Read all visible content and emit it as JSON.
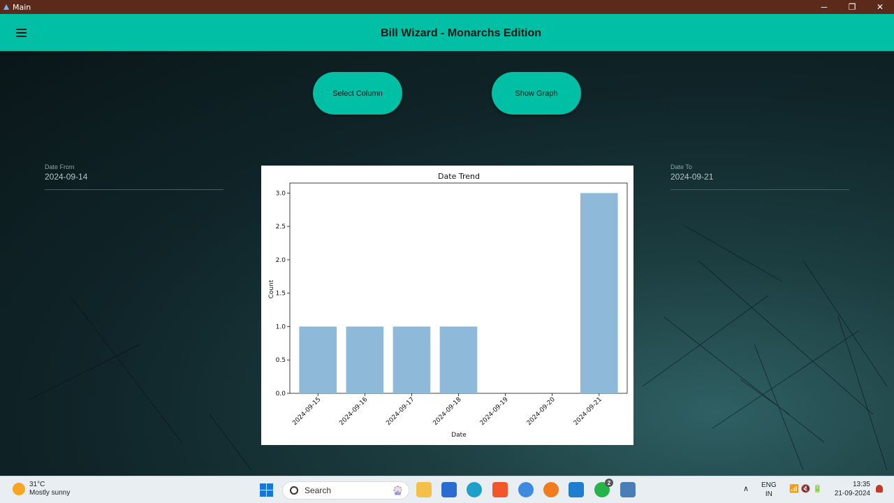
{
  "window": {
    "title": "Main",
    "controls": {
      "minimize": "─",
      "restore": "❐",
      "close": "✕"
    }
  },
  "toolbar": {
    "title": "Bill Wizard - Monarchs Edition",
    "menu_icon": "hamburger-menu-icon"
  },
  "buttons": {
    "select_column": "Select Column",
    "show_graph": "Show Graph"
  },
  "date_from": {
    "label": "Date From",
    "value": "2024-09-14"
  },
  "date_to": {
    "label": "Date To",
    "value": "2024-09-21"
  },
  "chart_data": {
    "type": "bar",
    "title": "Date Trend",
    "xlabel": "Date",
    "ylabel": "Count",
    "categories": [
      "2024-09-15",
      "2024-09-16",
      "2024-09-17",
      "2024-09-18",
      "2024-09-19",
      "2024-09-20",
      "2024-09-21"
    ],
    "values": [
      1,
      1,
      1,
      1,
      0,
      0,
      3
    ],
    "ylim": [
      0,
      3.15
    ],
    "yticks": [
      "0.0",
      "0.5",
      "1.0",
      "1.5",
      "2.0",
      "2.5",
      "3.0"
    ],
    "bar_color": "#8fb9d8",
    "grid": false
  },
  "taskbar": {
    "weather": {
      "temp": "31°C",
      "desc": "Mostly sunny"
    },
    "search_label": "Search",
    "apps": [
      "file-explorer-icon",
      "store-icon",
      "edge-icon",
      "brave-icon",
      "app-icon",
      "firefox-icon",
      "vscode-icon",
      "whatsapp-icon",
      "python-icon"
    ],
    "whatsapp_badge": "2",
    "tray": {
      "lang_line1": "ENG",
      "lang_line2": "IN",
      "time": "13:35",
      "date": "21-09-2024"
    }
  },
  "colors": {
    "accent": "#00bfa5",
    "titlebar": "#5c2a1a"
  }
}
